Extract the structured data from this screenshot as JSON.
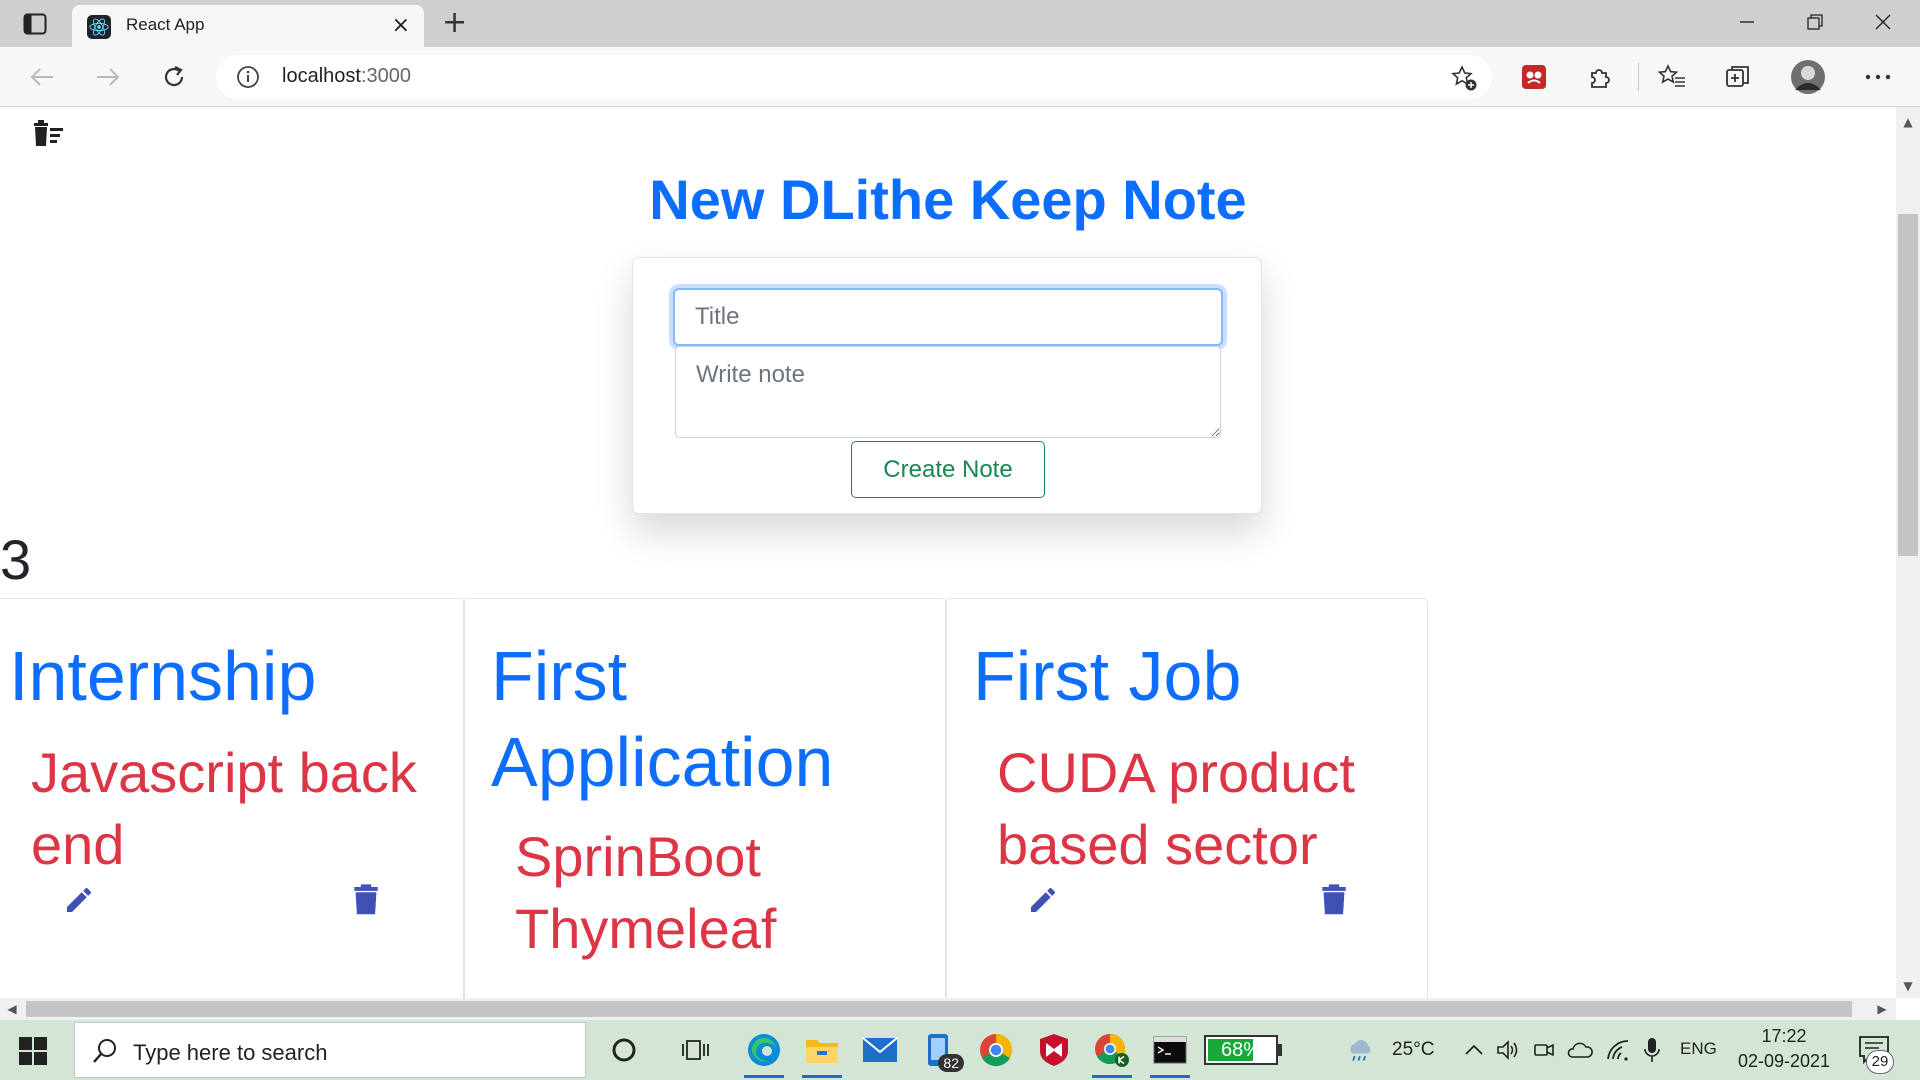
{
  "browser": {
    "tab_title": "React App",
    "tab_close": "×",
    "new_tab": "+",
    "url_host": "localhost",
    "url_port": ":3000"
  },
  "app": {
    "heading": "New DLithe Keep Note",
    "title_placeholder": "Title",
    "note_placeholder": "Write note",
    "create_label": "Create Note",
    "count": "3",
    "notes": [
      {
        "title": "Internship",
        "body": "Javascript back end"
      },
      {
        "title": "First Application",
        "body": "SprinBoot Thymeleaf"
      },
      {
        "title": "First Job",
        "body": "CUDA product based sector"
      }
    ]
  },
  "taskbar": {
    "search_placeholder": "Type here to search",
    "mail_badge": "82",
    "battery": "68%",
    "battery_level": 0.68,
    "temperature": "25°C",
    "language": "ENG",
    "time": "17:22",
    "date": "02-09-2021",
    "notifications": "29"
  },
  "scroll": {
    "up": "▲",
    "down": "▼",
    "left": "◀",
    "right": "▶"
  },
  "colors": {
    "primary": "#0d6efd",
    "danger": "#dc3545",
    "success": "#198754",
    "icon_indigo": "#3f51b5",
    "taskbar": "#d3e6d5"
  },
  "icons": {
    "clear_all": "delete-sweep-icon",
    "edit": "pencil-icon",
    "delete": "trash-icon"
  }
}
